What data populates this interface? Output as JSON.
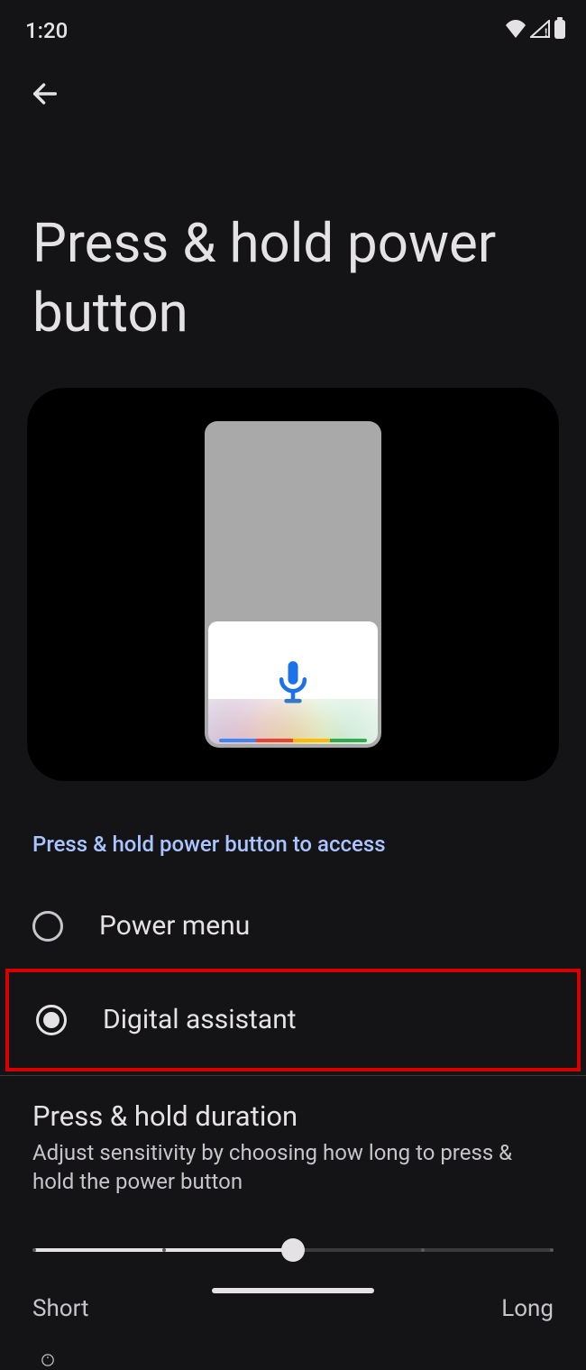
{
  "status": {
    "time": "1:20"
  },
  "header": {
    "title": "Press & hold power button"
  },
  "section": {
    "label": "Press & hold power button to access",
    "options": [
      {
        "label": "Power menu",
        "selected": false
      },
      {
        "label": "Digital assistant",
        "selected": true,
        "highlighted": true
      }
    ]
  },
  "duration": {
    "title": "Press & hold duration",
    "description": "Adjust sensitivity by choosing how long to press & hold the power button",
    "value_percent": 50,
    "ticks_percent": [
      0,
      25,
      50,
      75,
      100
    ],
    "min_label": "Short",
    "max_label": "Long"
  }
}
